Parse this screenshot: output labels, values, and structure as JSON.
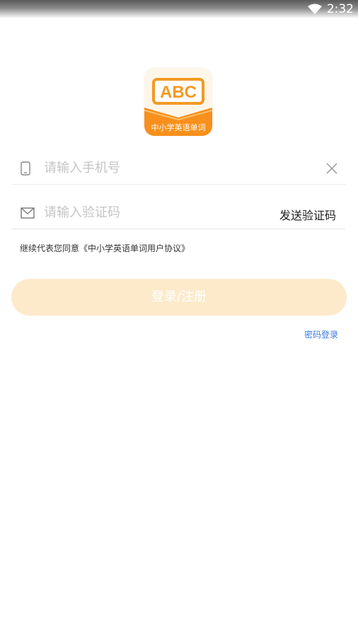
{
  "status_bar": {
    "time": "2:32"
  },
  "logo": {
    "top_text": "ABC",
    "bottom_text": "中小学英语单词"
  },
  "phone_field": {
    "placeholder": "请输入手机号",
    "value": ""
  },
  "code_field": {
    "placeholder": "请输入验证码",
    "value": "",
    "send_label": "发送验证码"
  },
  "agreement": {
    "text": "继续代表您同意《中小学英语单词用户协议》"
  },
  "login_button": {
    "label": "登录/注册"
  },
  "password_login": {
    "label": "密码登录"
  },
  "colors": {
    "accent": "#F7A53A",
    "button_disabled": "#FDEACB",
    "link": "#3C7BE0"
  }
}
